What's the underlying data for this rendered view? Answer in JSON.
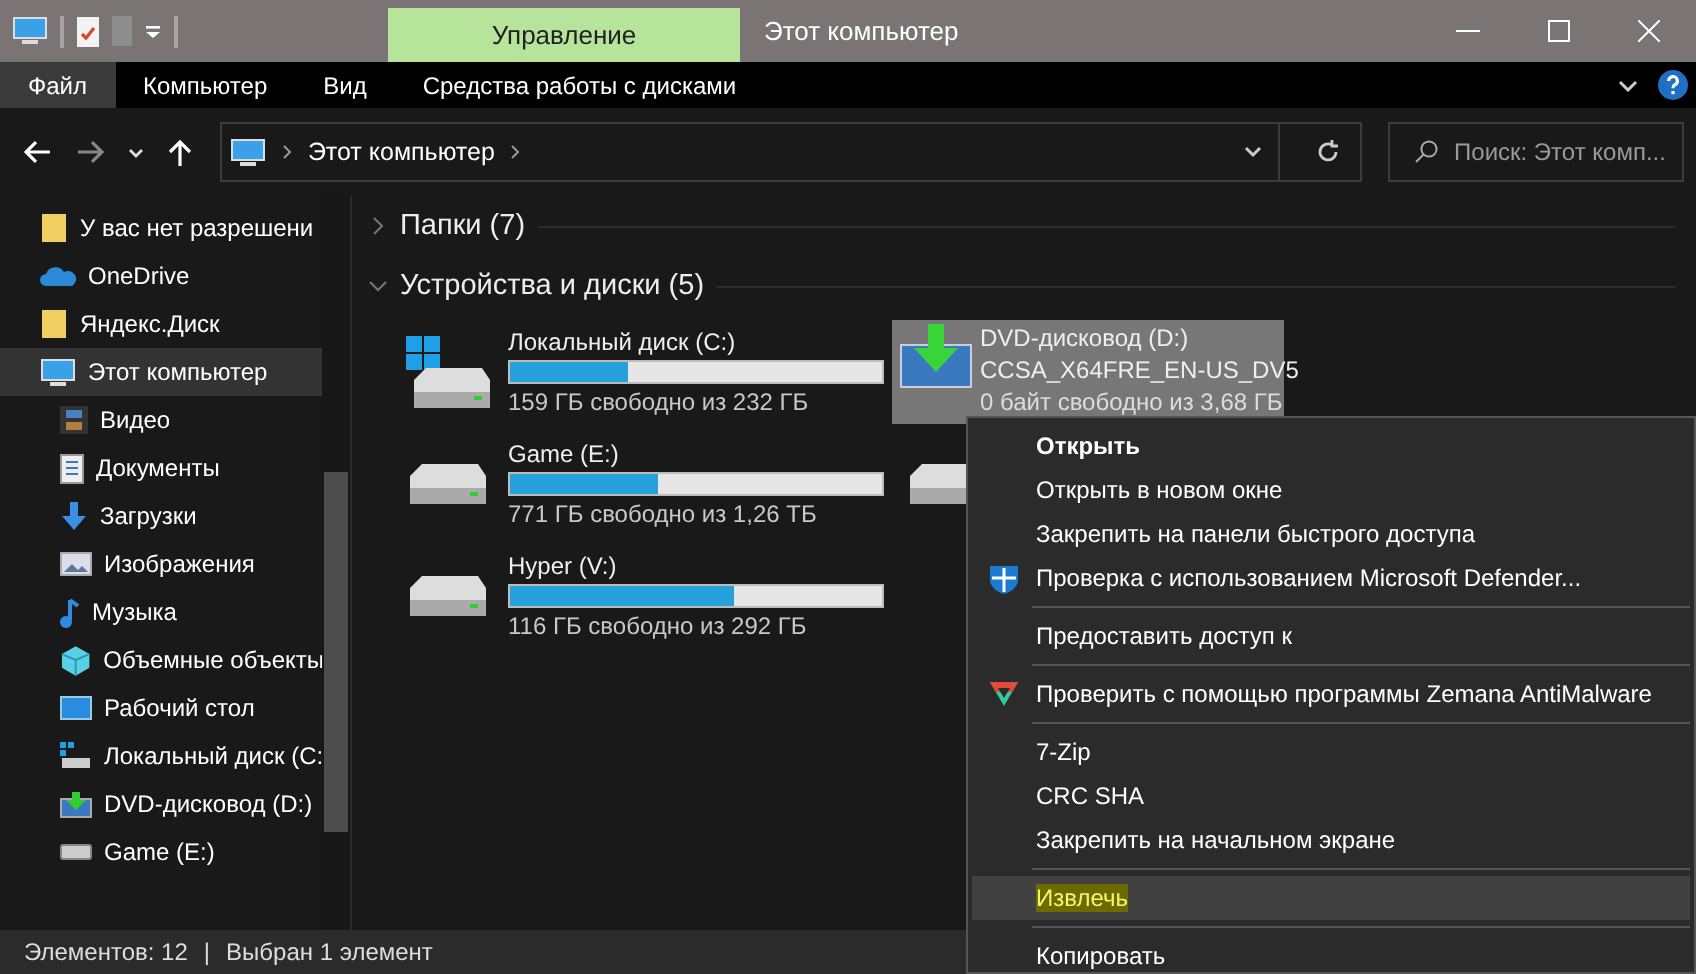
{
  "title_bar": {
    "context_tab": "Управление",
    "title": "Этот компьютер"
  },
  "ribbon_tabs": [
    {
      "label": "Файл",
      "selected": true
    },
    {
      "label": "Компьютер",
      "selected": false
    },
    {
      "label": "Вид",
      "selected": false
    },
    {
      "label": "Средства работы с дисками",
      "selected": false
    }
  ],
  "address_bar": {
    "path": "Этот компьютер"
  },
  "search": {
    "placeholder": "Поиск: Этот комп..."
  },
  "sidebar": {
    "items": [
      {
        "label": "У вас нет разрешени",
        "kind": "folder",
        "selected": false
      },
      {
        "label": "OneDrive",
        "kind": "cloud",
        "selected": false
      },
      {
        "label": "Яндекс.Диск",
        "kind": "folder",
        "selected": false
      },
      {
        "label": "Этот компьютер",
        "kind": "computer",
        "selected": true,
        "children": [
          {
            "label": "Видео",
            "kind": "video",
            "selected": false
          },
          {
            "label": "Документы",
            "kind": "documents",
            "selected": false
          },
          {
            "label": "Загрузки",
            "kind": "downloads",
            "selected": false
          },
          {
            "label": "Изображения",
            "kind": "pictures",
            "selected": false
          },
          {
            "label": "Музыка",
            "kind": "music",
            "selected": false
          },
          {
            "label": "Объемные объекты",
            "kind": "objects",
            "selected": false
          },
          {
            "label": "Рабочий стол",
            "kind": "desktop",
            "selected": false
          },
          {
            "label": "Локальный диск (C:",
            "kind": "system-drive",
            "selected": false
          },
          {
            "label": "DVD-дисковод (D:)",
            "kind": "dvd",
            "selected": false
          },
          {
            "label": "Game (E:)",
            "kind": "drive",
            "selected": false
          }
        ]
      }
    ]
  },
  "sections": [
    {
      "label": "Папки (7)",
      "expanded": false
    },
    {
      "label": "Устройства и диски (5)",
      "expanded": true
    }
  ],
  "drives": [
    {
      "name": "Локальный диск (C:)",
      "kind": "system-drive",
      "level": 0.315,
      "free": "159 ГБ свободно из 232 ГБ",
      "selected": false
    },
    {
      "name": "DVD-дисковод (D:)",
      "kind": "dvd",
      "label": "CCSA_X64FRE_EN-US_DV5",
      "free": "0 байт свободно из 3,68 ГБ",
      "selected": true
    },
    {
      "name": "Game (E:)",
      "kind": "drive",
      "level": 0.4,
      "free": "771 ГБ свободно из 1,26 ТБ",
      "selected": false
    },
    {
      "kind": "drive",
      "selected": false
    },
    {
      "name": "Hyper (V:)",
      "kind": "drive",
      "level": 0.6,
      "free": "116 ГБ свободно из 292 ГБ",
      "selected": false
    }
  ],
  "context_menu": [
    {
      "kind": "item",
      "label": "Открыть",
      "bold": true,
      "selected": false
    },
    {
      "kind": "item",
      "label": "Открыть в новом окне",
      "selected": false
    },
    {
      "kind": "item",
      "label": "Закрепить на панели быстрого доступа",
      "selected": false
    },
    {
      "kind": "defender-item",
      "label": "Проверка с использованием Microsoft Defender...",
      "selected": false
    },
    {
      "kind": "separator"
    },
    {
      "kind": "item",
      "label": "Предоставить доступ к",
      "selected": false
    },
    {
      "kind": "separator"
    },
    {
      "kind": "antimalware-item",
      "label": "Проверить с помощью программы Zemana AntiMalware",
      "selected": false
    },
    {
      "kind": "separator"
    },
    {
      "kind": "item",
      "label": "7-Zip",
      "selected": false
    },
    {
      "kind": "item",
      "label": "CRC SHA",
      "selected": false
    },
    {
      "kind": "item",
      "label": "Закрепить на начальном экране",
      "selected": false
    },
    {
      "kind": "separator"
    },
    {
      "kind": "item",
      "label": "Извлечь",
      "selected": true,
      "highlighted": true
    },
    {
      "kind": "separator"
    },
    {
      "kind": "item",
      "label": "Копировать",
      "selected": false
    }
  ],
  "status_bar": {
    "items": "Элементов: 12",
    "divider": "|",
    "selection": "Выбран 1 элемент"
  }
}
